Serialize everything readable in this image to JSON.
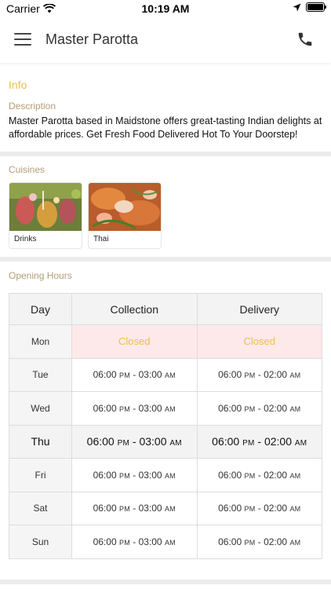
{
  "status_bar": {
    "carrier": "Carrier",
    "time": "10:19 AM",
    "icons": [
      "wifi-icon",
      "location-arrow-icon",
      "battery-icon"
    ]
  },
  "header": {
    "title": "Master Parotta",
    "menu_icon": "hamburger-menu-icon",
    "call_icon": "phone-icon"
  },
  "info": {
    "heading": "Info",
    "description_label": "Description",
    "description": "Master Parotta based in Maidstone offers great-tasting Indian delights at affordable prices. Get Fresh Food Delivered Hot To Your Doorstep!"
  },
  "cuisines": {
    "heading": "Cuisines",
    "items": [
      {
        "name": "Drinks"
      },
      {
        "name": "Thai"
      }
    ]
  },
  "opening_hours": {
    "heading": "Opening Hours",
    "columns": [
      "Day",
      "Collection",
      "Delivery"
    ],
    "rows": [
      {
        "day": "Mon",
        "collection": "Closed",
        "delivery": "Closed"
      },
      {
        "day": "Tue",
        "collection": {
          "from": "06:00",
          "from_ampm": "PM",
          "to": "03:00",
          "to_ampm": "AM"
        },
        "delivery": {
          "from": "06:00",
          "from_ampm": "PM",
          "to": "02:00",
          "to_ampm": "AM"
        }
      },
      {
        "day": "Wed",
        "collection": {
          "from": "06:00",
          "from_ampm": "PM",
          "to": "03:00",
          "to_ampm": "AM"
        },
        "delivery": {
          "from": "06:00",
          "from_ampm": "PM",
          "to": "02:00",
          "to_ampm": "AM"
        }
      },
      {
        "day": "Thu",
        "collection": {
          "from": "06:00",
          "from_ampm": "PM",
          "to": "03:00",
          "to_ampm": "AM"
        },
        "delivery": {
          "from": "06:00",
          "from_ampm": "PM",
          "to": "02:00",
          "to_ampm": "AM"
        }
      },
      {
        "day": "Fri",
        "collection": {
          "from": "06:00",
          "from_ampm": "PM",
          "to": "03:00",
          "to_ampm": "AM"
        },
        "delivery": {
          "from": "06:00",
          "from_ampm": "PM",
          "to": "02:00",
          "to_ampm": "AM"
        }
      },
      {
        "day": "Sat",
        "collection": {
          "from": "06:00",
          "from_ampm": "PM",
          "to": "03:00",
          "to_ampm": "AM"
        },
        "delivery": {
          "from": "06:00",
          "from_ampm": "PM",
          "to": "02:00",
          "to_ampm": "AM"
        }
      },
      {
        "day": "Sun",
        "collection": {
          "from": "06:00",
          "from_ampm": "PM",
          "to": "03:00",
          "to_ampm": "AM"
        },
        "delivery": {
          "from": "06:00",
          "from_ampm": "PM",
          "to": "02:00",
          "to_ampm": "AM"
        }
      }
    ]
  },
  "colors": {
    "accent_gold": "#e8c24a",
    "label_tan": "#b39d78",
    "closed_bg": "#fde9e9",
    "divider": "#ececec"
  }
}
